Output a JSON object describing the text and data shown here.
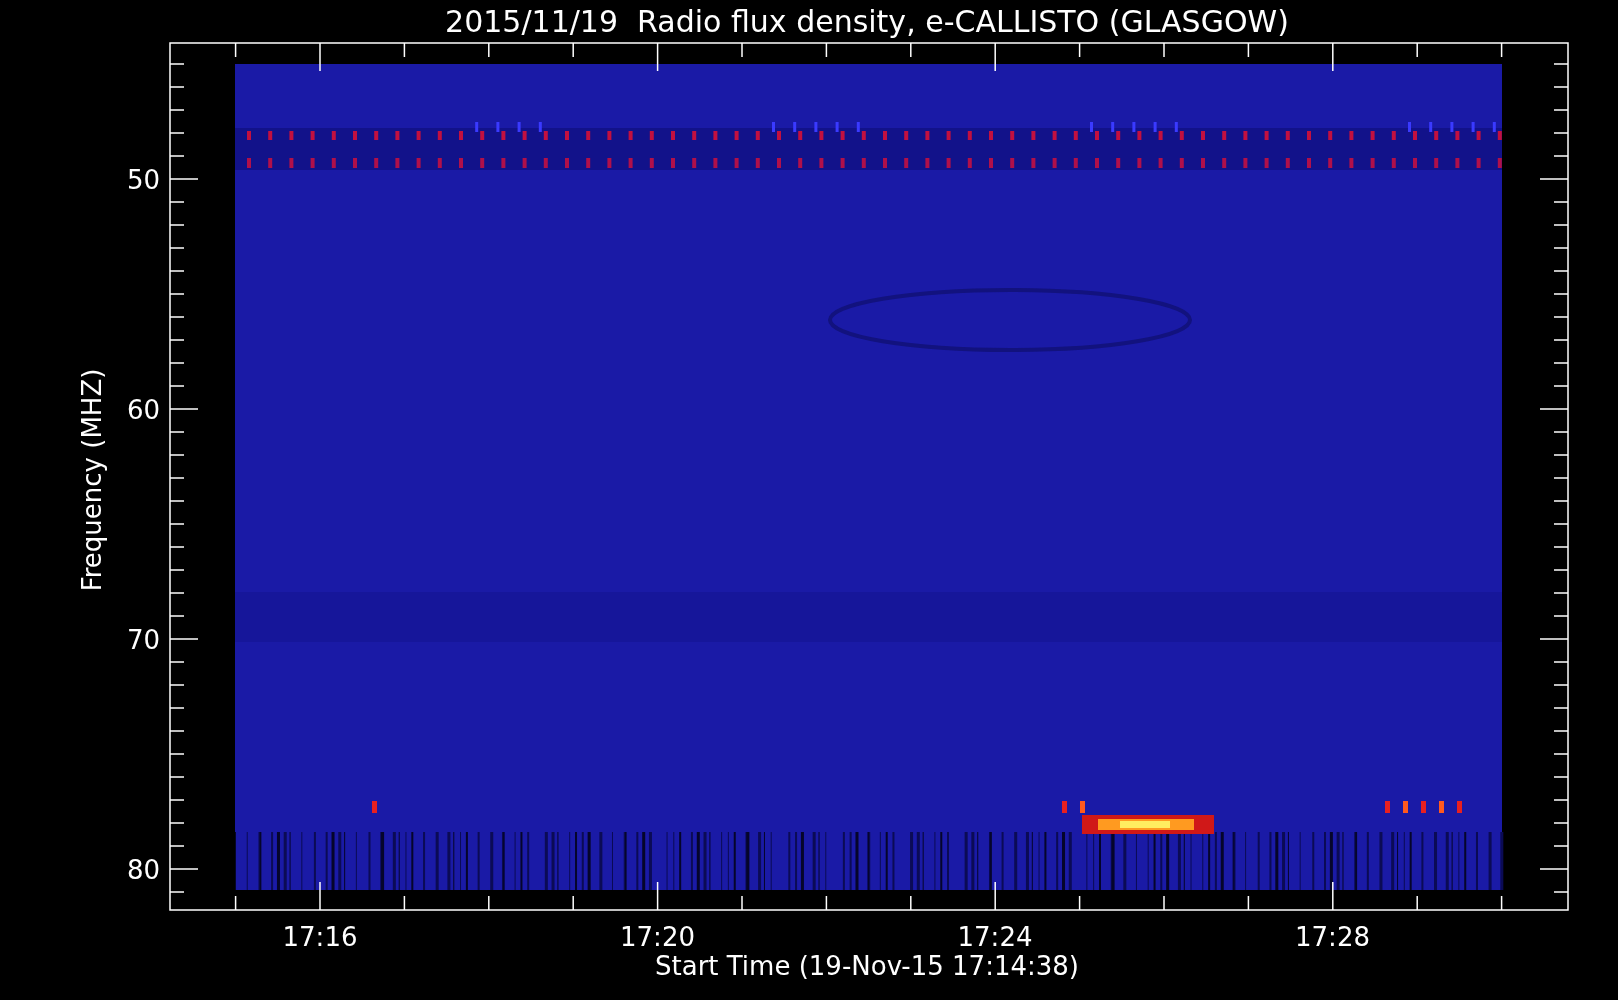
{
  "title": "2015/11/19  Radio flux density, e-CALLISTO (GLASGOW)",
  "y_axis": {
    "label": "Frequency (MHZ)",
    "ticks": [
      "50",
      "60",
      "70",
      "80"
    ]
  },
  "x_axis": {
    "label": "Start Time (19-Nov-15 17:14:38)",
    "ticks": [
      "17:16",
      "17:20",
      "17:24",
      "17:28"
    ]
  }
}
